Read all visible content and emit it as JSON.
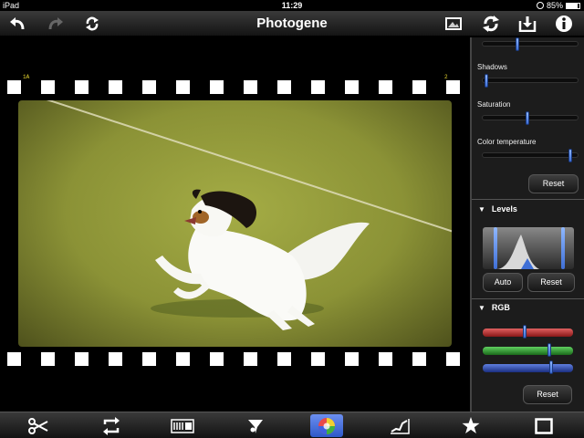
{
  "status": {
    "device": "iPad",
    "time": "11:29",
    "battery": "85%"
  },
  "nav": {
    "title": "Photogene"
  },
  "film": {
    "frame_label_left": "1A ",
    "frame_label_right": "2"
  },
  "panel": {
    "brightness_level": 0.35,
    "shadows": {
      "label": "Shadows",
      "level": 0.02
    },
    "saturation": {
      "label": "Saturation",
      "level": 0.45
    },
    "color_temperature": {
      "label": "Color temperature",
      "level": 0.9
    },
    "reset1": "Reset",
    "levels": {
      "label": "Levels",
      "auto": "Auto",
      "reset": "Reset",
      "low": 0.12,
      "high": 0.86
    },
    "rgb": {
      "label": "RGB",
      "reset": "Reset",
      "red_level": 0.44,
      "green_level": 0.72,
      "blue_level": 0.74
    }
  },
  "colors": {
    "accent": "#3f6fd6",
    "red": "#c03030",
    "green": "#2f9a2f",
    "blue": "#2a4fb0"
  },
  "toolbar": {
    "icons": [
      "scissors-icon",
      "repeat-icon",
      "frames-icon",
      "filter-icon",
      "color-wheel-icon",
      "curve-icon",
      "star-icon",
      "frame-square-icon"
    ],
    "selected": "color-wheel-icon"
  }
}
